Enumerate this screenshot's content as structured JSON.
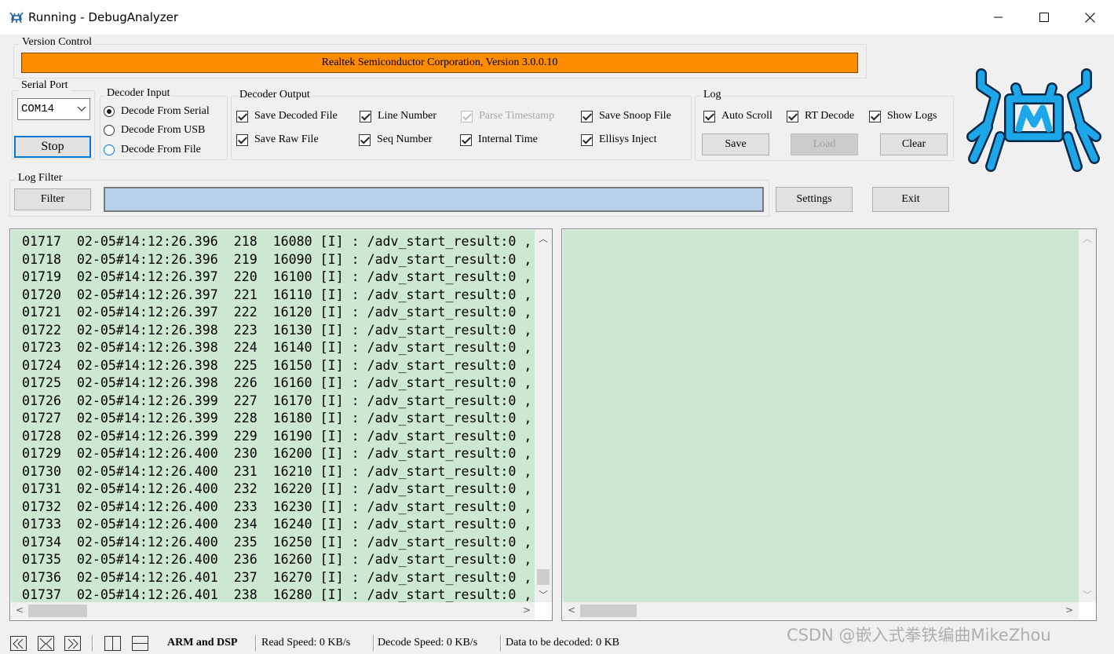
{
  "window": {
    "title": "Running - DebugAnalyzer",
    "icon": "realtek-crab-icon",
    "controls": [
      "minimize-icon",
      "maximize-icon",
      "close-icon"
    ]
  },
  "version_control": {
    "group_title": "Version Control",
    "version_text": "Realtek Semiconductor Corporation, Version 3.0.0.10",
    "bar_color": "#ff8c00"
  },
  "serial_port": {
    "group_title": "Serial Port",
    "selected": "COM14",
    "stop_label": "Stop"
  },
  "decoder_input": {
    "group_title": "Decoder Input",
    "options": [
      {
        "label": "Decode From Serial",
        "checked": true
      },
      {
        "label": "Decode From USB",
        "checked": false
      },
      {
        "label": "Decode From File",
        "checked": false
      }
    ]
  },
  "decoder_output": {
    "group_title": "Decoder Output",
    "options": [
      {
        "label": "Save Decoded File",
        "checked": true,
        "enabled": true
      },
      {
        "label": "Line Number",
        "checked": true,
        "enabled": true
      },
      {
        "label": "Parse Timestamp",
        "checked": true,
        "enabled": false
      },
      {
        "label": "Save Snoop File",
        "checked": true,
        "enabled": true
      },
      {
        "label": "Save Raw File",
        "checked": true,
        "enabled": true
      },
      {
        "label": "Seq Number",
        "checked": true,
        "enabled": true
      },
      {
        "label": "Internal Time",
        "checked": true,
        "enabled": true
      },
      {
        "label": "Ellisys Inject",
        "checked": true,
        "enabled": true
      }
    ]
  },
  "log": {
    "group_title": "Log",
    "options": [
      {
        "label": "Auto Scroll",
        "checked": true
      },
      {
        "label": "RT Decode",
        "checked": true
      },
      {
        "label": "Show Logs",
        "checked": true
      }
    ],
    "save_label": "Save",
    "load_label": "Load",
    "clear_label": "Clear"
  },
  "log_filter": {
    "group_title": "Log Filter",
    "filter_label": "Filter",
    "value": "",
    "settings_label": "Settings",
    "exit_label": "Exit"
  },
  "log_lines": [
    "01717  02-05#14:12:26.396  218  16080 [I] : /adv_start_result:0 ,",
    "01718  02-05#14:12:26.396  219  16090 [I] : /adv_start_result:0 ,",
    "01719  02-05#14:12:26.397  220  16100 [I] : /adv_start_result:0 ,",
    "01720  02-05#14:12:26.397  221  16110 [I] : /adv_start_result:0 ,",
    "01721  02-05#14:12:26.397  222  16120 [I] : /adv_start_result:0 ,",
    "01722  02-05#14:12:26.398  223  16130 [I] : /adv_start_result:0 ,",
    "01723  02-05#14:12:26.398  224  16140 [I] : /adv_start_result:0 ,",
    "01724  02-05#14:12:26.398  225  16150 [I] : /adv_start_result:0 ,",
    "01725  02-05#14:12:26.398  226  16160 [I] : /adv_start_result:0 ,",
    "01726  02-05#14:12:26.399  227  16170 [I] : /adv_start_result:0 ,",
    "01727  02-05#14:12:26.399  228  16180 [I] : /adv_start_result:0 ,",
    "01728  02-05#14:12:26.399  229  16190 [I] : /adv_start_result:0 ,",
    "01729  02-05#14:12:26.400  230  16200 [I] : /adv_start_result:0 ,",
    "01730  02-05#14:12:26.400  231  16210 [I] : /adv_start_result:0 ,",
    "01731  02-05#14:12:26.400  232  16220 [I] : /adv_start_result:0 ,",
    "01732  02-05#14:12:26.400  233  16230 [I] : /adv_start_result:0 ,",
    "01733  02-05#14:12:26.400  234  16240 [I] : /adv_start_result:0 ,",
    "01734  02-05#14:12:26.400  235  16250 [I] : /adv_start_result:0 ,",
    "01735  02-05#14:12:26.400  236  16260 [I] : /adv_start_result:0 ,",
    "01736  02-05#14:12:26.401  237  16270 [I] : /adv_start_result:0 ,",
    "01737  02-05#14:12:26.401  238  16280 [I] : /adv_start_result:0 ,"
  ],
  "pane_color": "#cde8d0",
  "statusbar": {
    "mode": "ARM and DSP",
    "read_speed": "Read Speed:  0 KB/s",
    "decode_speed": "Decode Speed:  0 KB/s",
    "pending": "Data to be decoded:  0 KB"
  },
  "watermark": "CSDN @嵌入式拳铁编曲MikeZhou"
}
